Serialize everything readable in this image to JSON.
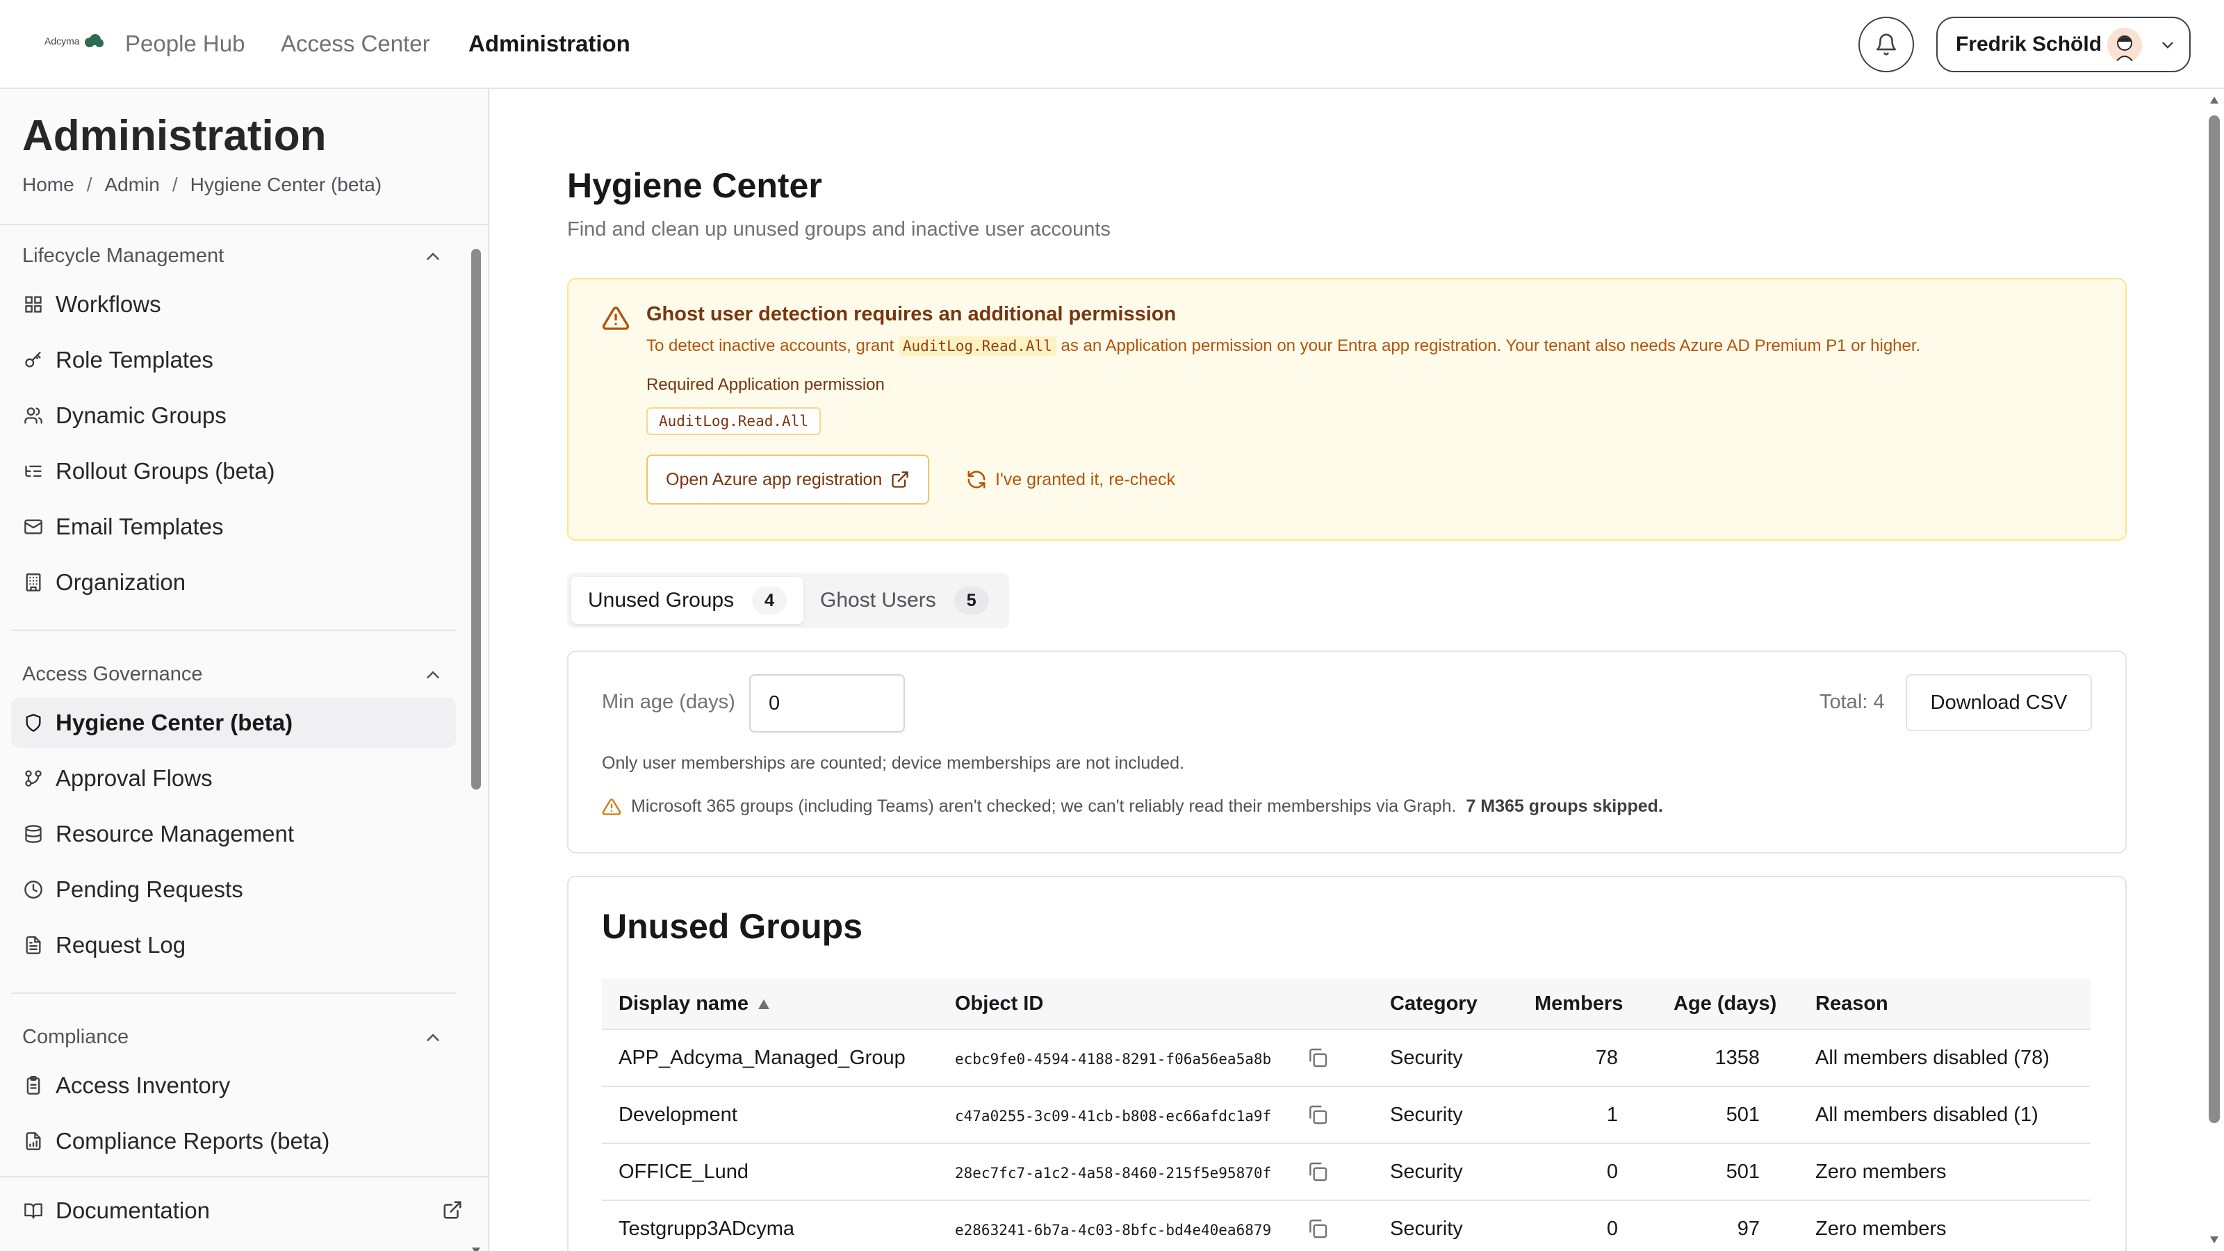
{
  "app": {
    "brand": "Adcyma",
    "nav": [
      "People Hub",
      "Access Center",
      "Administration"
    ],
    "active_nav": "Administration",
    "user_name": "Fredrik Schöld"
  },
  "sidebar": {
    "title": "Administration",
    "breadcrumb": [
      "Home",
      "Admin",
      "Hygiene Center (beta)"
    ],
    "sections": [
      {
        "title": "Lifecycle Management",
        "items": [
          "Workflows",
          "Role Templates",
          "Dynamic Groups",
          "Rollout Groups (beta)",
          "Email Templates",
          "Organization"
        ]
      },
      {
        "title": "Access Governance",
        "items": [
          "Hygiene Center (beta)",
          "Approval Flows",
          "Resource Management",
          "Pending Requests",
          "Request Log"
        ]
      },
      {
        "title": "Compliance",
        "items": [
          "Access Inventory",
          "Compliance Reports (beta)"
        ]
      }
    ],
    "active_item": "Hygiene Center (beta)",
    "documentation": "Documentation"
  },
  "page": {
    "title": "Hygiene Center",
    "subtitle": "Find and clean up unused groups and inactive user accounts"
  },
  "alert": {
    "title": "Ghost user detection requires an additional permission",
    "desc_before": "To detect inactive accounts, grant ",
    "desc_code": "AuditLog.Read.All",
    "desc_after": " as an Application permission on your Entra app registration. Your tenant also needs Azure AD Premium P1 or higher.",
    "required_label": "Required Application permission",
    "required_code": "AuditLog.Read.All",
    "open_button": "Open Azure app registration",
    "recheck_button": "I've granted it, re-check"
  },
  "tabs": [
    {
      "label": "Unused Groups",
      "count": "4"
    },
    {
      "label": "Ghost Users",
      "count": "5"
    }
  ],
  "filters": {
    "min_age_label": "Min age (days)",
    "min_age_value": "0",
    "total": "Total: 4",
    "download": "Download CSV",
    "note": "Only user memberships are counted; device memberships are not included.",
    "warning": "Microsoft 365 groups (including Teams) aren't checked; we can't reliably read their memberships via Graph.",
    "warning_strong": "7 M365 groups skipped."
  },
  "table": {
    "title": "Unused Groups",
    "columns": [
      "Display name",
      "Object ID",
      "Category",
      "Members",
      "Age (days)",
      "Reason"
    ],
    "rows": [
      {
        "name": "APP_Adcyma_Managed_Group",
        "id": "ecbc9fe0-4594-4188-8291-f06a56ea5a8b",
        "category": "Security",
        "members": "78",
        "age": "1358",
        "reason": "All members disabled (78)"
      },
      {
        "name": "Development",
        "id": "c47a0255-3c09-41cb-b808-ec66afdc1a9f",
        "category": "Security",
        "members": "1",
        "age": "501",
        "reason": "All members disabled (1)"
      },
      {
        "name": "OFFICE_Lund",
        "id": "28ec7fc7-a1c2-4a58-8460-215f5e95870f",
        "category": "Security",
        "members": "0",
        "age": "501",
        "reason": "Zero members"
      },
      {
        "name": "Testgrupp3ADcyma",
        "id": "e2863241-6b7a-4c03-8bfc-bd4e40ea6879",
        "category": "Security",
        "members": "0",
        "age": "97",
        "reason": "Zero members"
      }
    ]
  }
}
